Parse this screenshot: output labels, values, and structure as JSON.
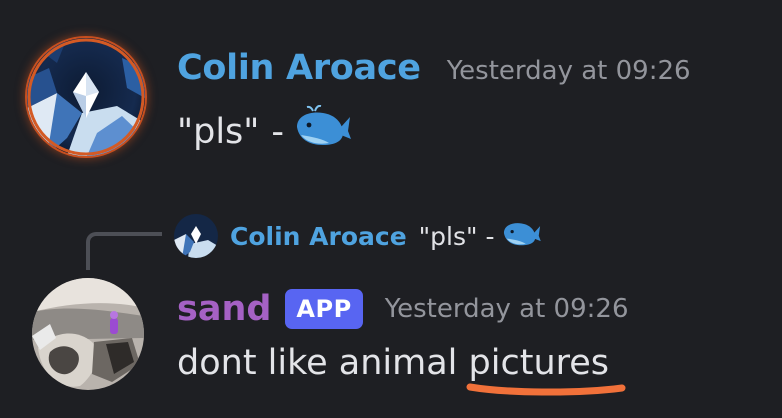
{
  "messages": [
    {
      "author": "Colin Aroace",
      "timestamp": "Yesterday at 09:26",
      "content": "\"pls\"",
      "separator": "-",
      "emoji": "whale"
    },
    {
      "reply_to": {
        "author": "Colin Aroace",
        "content": "\"pls\"",
        "separator": "-",
        "emoji": "whale"
      },
      "author": "sand",
      "badge": "APP",
      "timestamp": "Yesterday at 09:26",
      "content_before": "dont like animal",
      "misspelled_word": "pictures"
    }
  ],
  "colors": {
    "background": "#1e1f23",
    "author_colin": "#4fa3e0",
    "author_sand": "#a561c4",
    "app_badge": "#5865f2",
    "timestamp": "#93959c",
    "spellcheck_underline": "#f1713a"
  }
}
